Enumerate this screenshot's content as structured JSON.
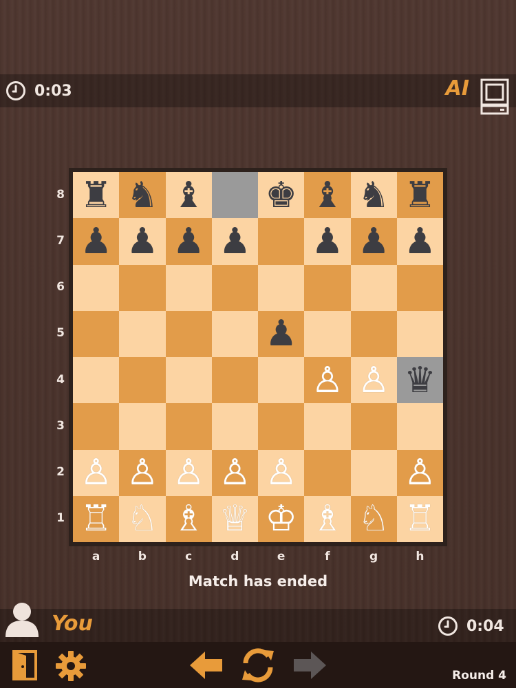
{
  "opponent": {
    "name": "AI",
    "clock": "0:03",
    "avatar_icon": "computer-icon"
  },
  "player": {
    "name": "You",
    "clock": "0:04",
    "avatar_icon": "user-icon"
  },
  "status_text": "Match has ended",
  "round_label": "Round 4",
  "board": {
    "files": [
      "a",
      "b",
      "c",
      "d",
      "e",
      "f",
      "g",
      "h"
    ],
    "ranks": [
      "8",
      "7",
      "6",
      "5",
      "4",
      "3",
      "2",
      "1"
    ],
    "highlighted_squares": [
      "d8",
      "h4"
    ],
    "pieces": {
      "8": [
        "♜",
        "♞",
        "♝",
        "",
        "♚",
        "♝",
        "♞",
        "♜"
      ],
      "7": [
        "♟",
        "♟",
        "♟",
        "♟",
        "",
        "♟",
        "♟",
        "♟"
      ],
      "6": [
        "",
        "",
        "",
        "",
        "",
        "",
        "",
        ""
      ],
      "5": [
        "",
        "",
        "",
        "",
        "♟",
        "",
        "",
        ""
      ],
      "4": [
        "",
        "",
        "",
        "",
        "",
        "♙",
        "♙",
        "♛"
      ],
      "3": [
        "",
        "",
        "",
        "",
        "",
        "",
        "",
        ""
      ],
      "2": [
        "♙",
        "♙",
        "♙",
        "♙",
        "♙",
        "",
        "",
        "♙"
      ],
      "1": [
        "♖",
        "♘",
        "♗",
        "♕",
        "♔",
        "♗",
        "♘",
        "♖"
      ]
    }
  },
  "colors": {
    "light_square": "#fcd4a3",
    "dark_square": "#e29c4a",
    "highlight": "#9a9a9a",
    "accent": "#e89b3a"
  },
  "toolbar": [
    "exit-door-icon",
    "settings-gear-icon",
    "undo-arrow-left-icon",
    "restart-rotate-icon",
    "redo-arrow-right-icon"
  ]
}
